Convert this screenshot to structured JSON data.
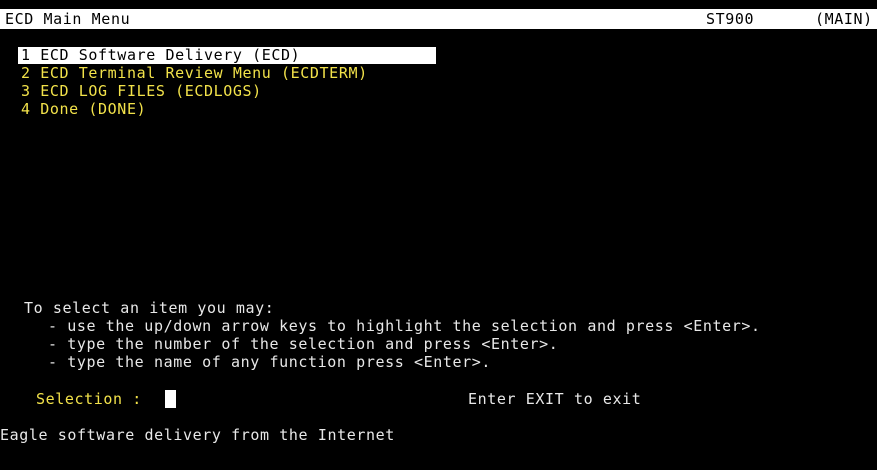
{
  "header": {
    "title": "ECD Main Menu",
    "system": "ST900",
    "screen": "(MAIN)"
  },
  "menu": {
    "items": [
      {
        "label": "1 ECD Software Delivery (ECD)",
        "selected": true
      },
      {
        "label": "2 ECD Terminal Review Menu (ECDTERM)",
        "selected": false
      },
      {
        "label": "3 ECD LOG FILES (ECDLOGS)",
        "selected": false
      },
      {
        "label": "4 Done (DONE)",
        "selected": false
      }
    ]
  },
  "help": {
    "intro": "To select an item you may:",
    "lines": [
      "- use the up/down arrow keys to highlight the selection and press <Enter>.",
      "- type the number of the selection and press <Enter>.",
      "- type the name of any function press <Enter>."
    ]
  },
  "prompt": {
    "label": "Selection :",
    "value": "",
    "exit_hint": "Enter EXIT to exit"
  },
  "status": {
    "message": "Eagle software delivery from the Internet"
  },
  "colors": {
    "background": "#000000",
    "menu_text": "#f2e24a",
    "highlight_bg": "#ffffff",
    "normal_text": "#e8e8e8"
  }
}
